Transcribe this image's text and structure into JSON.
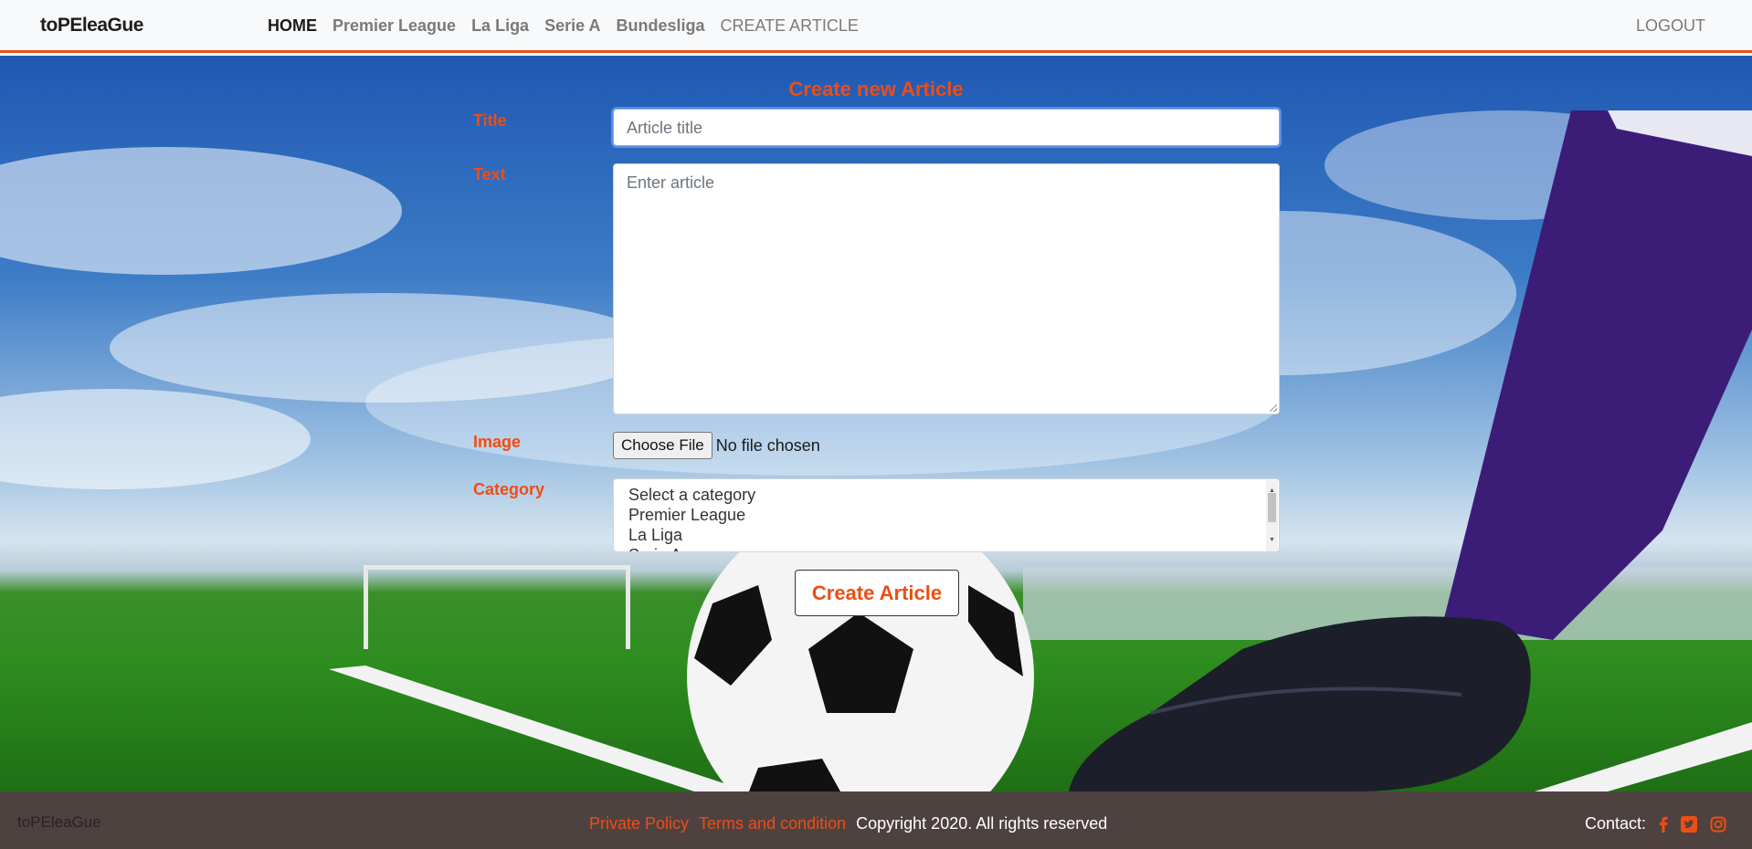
{
  "navbar": {
    "brand": "toPEleaGue",
    "links": [
      {
        "label": "HOME"
      },
      {
        "label": "Premier League"
      },
      {
        "label": "La Liga"
      },
      {
        "label": "Serie A"
      },
      {
        "label": "Bundesliga"
      },
      {
        "label": "CREATE ARTICLE"
      }
    ],
    "logout": "LOGOUT"
  },
  "form": {
    "heading": "Create new Article",
    "title_label": "Title",
    "title_placeholder": "Article title",
    "text_label": "Text",
    "text_placeholder": "Enter article",
    "image_label": "Image",
    "file_button": "Choose File",
    "file_status": "No file chosen",
    "category_label": "Category",
    "category_options": [
      "Select a category",
      "Premier League",
      "La Liga",
      "Serie A"
    ],
    "submit": "Create Article"
  },
  "footer": {
    "brand": "toPEleaGue",
    "privacy": "Private Policy",
    "terms": "Terms and condition",
    "copyright": "Copyright 2020. All rights reserved",
    "contact": "Contact:",
    "social_icons": [
      "facebook-icon",
      "twitter-icon",
      "instagram-icon"
    ]
  },
  "colors": {
    "accent": "#ee4d14",
    "footer_bg": "#4e4241",
    "navbar_bg": "#f8f9fa"
  }
}
